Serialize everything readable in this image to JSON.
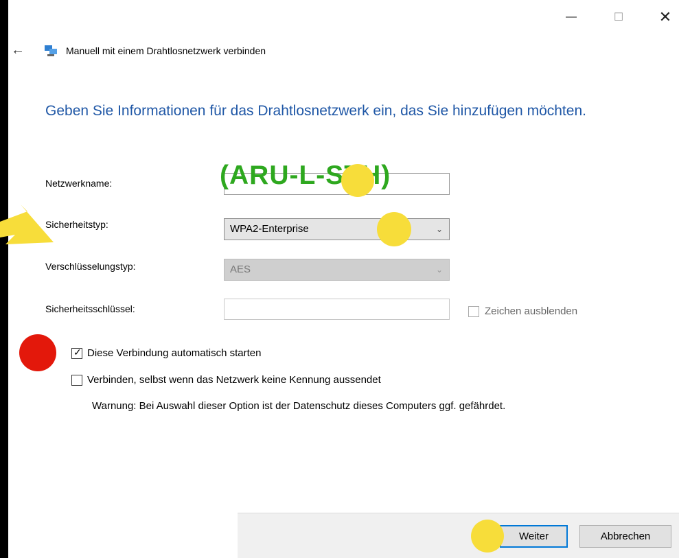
{
  "window": {
    "title": "Manuell mit einem Drahtlosnetzwerk verbinden",
    "controls": {
      "minimize": "—",
      "maximize": "☐",
      "close": "✕"
    },
    "back_icon": "←"
  },
  "heading": "Geben Sie Informationen für das Drahtlosnetzwerk ein, das Sie hinzufügen möchten.",
  "form": {
    "network_name": {
      "label": "Netzwerkname:",
      "value": "(ARU-L-STH)"
    },
    "security_type": {
      "label": "Sicherheitstyp:",
      "value": "WPA2-Enterprise"
    },
    "encryption_type": {
      "label": "Verschlüsselungstyp:",
      "value": "AES"
    },
    "security_key": {
      "label": "Sicherheitsschlüssel:",
      "value": "",
      "hide_characters": {
        "label": "Zeichen ausblenden",
        "checked": false
      }
    },
    "auto_start": {
      "label": "Diese Verbindung automatisch starten",
      "checked": true
    },
    "connect_hidden": {
      "label": "Verbinden, selbst wenn das Netzwerk keine Kennung aussendet",
      "checked": false
    },
    "warning": "Warnung: Bei Auswahl dieser Option ist der Datenschutz dieses Computers ggf. gefährdet."
  },
  "buttons": {
    "next": "Weiter",
    "cancel": "Abbrechen"
  },
  "annotation_text": "(ARU-L-STH)",
  "colors": {
    "heading": "#1f57a6",
    "highlight_yellow": "#f7dd3a",
    "highlight_red": "#e3180b",
    "annotation_green": "#2ea81f",
    "primary_border": "#0078d7"
  }
}
